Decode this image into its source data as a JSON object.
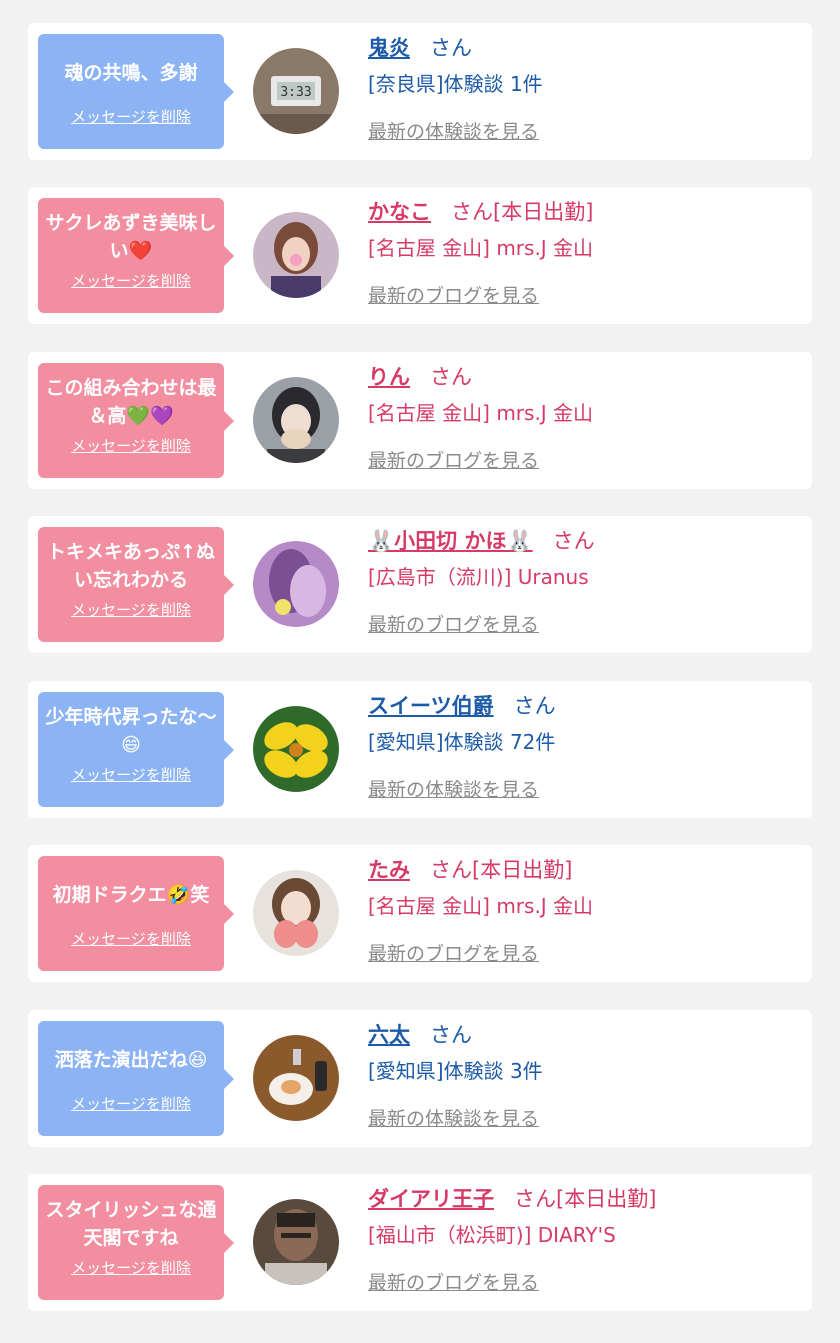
{
  "cards": [
    {
      "type": "blue",
      "message": "魂の共鳴、多謝",
      "delete_label": "メッセージを削除",
      "name": "鬼炎",
      "suffix": "さん",
      "info": "[奈良県]体験談 1件",
      "link": "最新の体験談を見る",
      "avatar": "clock-photo-avatar"
    },
    {
      "type": "pink",
      "message": "サクレあずき美味しい❤️",
      "delete_label": "メッセージを削除",
      "name": "かなこ",
      "suffix": "さん[本日出勤]",
      "info": "[名古屋 金山] mrs.J 金山",
      "link": "最新のブログを見る",
      "avatar": "woman-photo-avatar"
    },
    {
      "type": "pink",
      "message": "この組み合わせは最＆高💚💜",
      "delete_label": "メッセージを削除",
      "name": "りん",
      "suffix": "さん",
      "info": "[名古屋 金山] mrs.J 金山",
      "link": "最新のブログを見る",
      "avatar": "woman-masked-photo-avatar"
    },
    {
      "type": "pink",
      "message": "トキメキあっぷ↑ぬい忘れわかる",
      "delete_label": "メッセージを削除",
      "name": "🐰小田切 かほ🐰",
      "suffix": "さん",
      "info": "[広島市（流川)] Uranus",
      "link": "最新のブログを見る",
      "avatar": "purple-photo-avatar"
    },
    {
      "type": "blue",
      "message": "少年時代昇ったな〜😄",
      "delete_label": "メッセージを削除",
      "name": "スイーツ伯爵",
      "suffix": "さん",
      "info": "[愛知県]体験談 72件",
      "link": "最新の体験談を見る",
      "avatar": "yellow-flower-avatar"
    },
    {
      "type": "pink",
      "message": "初期ドラクエ🤣笑",
      "delete_label": "メッセージを削除",
      "name": "たみ",
      "suffix": "さん[本日出勤]",
      "info": "[名古屋 金山] mrs.J 金山",
      "link": "最新のブログを見る",
      "avatar": "woman-strawberry-photo-avatar"
    },
    {
      "type": "blue",
      "message": "洒落た演出だね😆",
      "delete_label": "メッセージを削除",
      "name": "六太",
      "suffix": "さん",
      "info": "[愛知県]体験談 3件",
      "link": "最新の体験談を見る",
      "avatar": "food-table-avatar"
    },
    {
      "type": "pink",
      "message": "スタイリッシュな通天閣ですね",
      "delete_label": "メッセージを削除",
      "name": "ダイアリ王子",
      "suffix": "さん[本日出勤]",
      "info": "[福山市（松浜町)] DIARY'S",
      "link": "最新のブログを見る",
      "avatar": "man-portrait-avatar"
    }
  ]
}
